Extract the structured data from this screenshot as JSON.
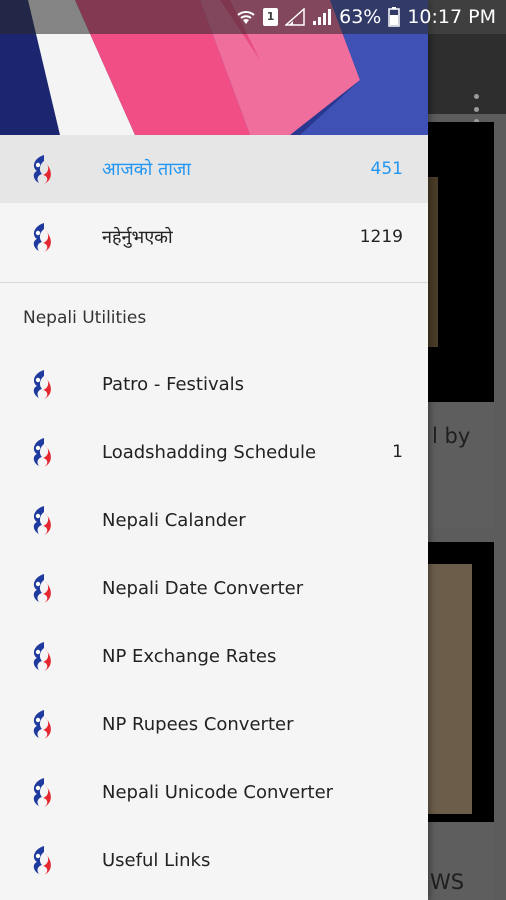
{
  "status_bar": {
    "battery_percent": "63%",
    "time": "10:17 PM",
    "sim_label": "1",
    "icons": [
      "wifi-icon",
      "sim-icon",
      "signal-icon",
      "signal-icon",
      "battery-icon"
    ]
  },
  "background": {
    "snippet_1": "l by",
    "snippet_2": "WS"
  },
  "drawer": {
    "top_items": [
      {
        "label": "आजको ताजा",
        "count": "451",
        "selected": true
      },
      {
        "label": "नहेर्नुभएको",
        "count": "1219",
        "selected": false
      }
    ],
    "section_title": "Nepali Utilities",
    "utility_items": [
      {
        "label": "Patro - Festivals",
        "count": ""
      },
      {
        "label": "Loadshadding Schedule",
        "count": "1"
      },
      {
        "label": "Nepali Calander",
        "count": ""
      },
      {
        "label": "Nepali Date Converter",
        "count": ""
      },
      {
        "label": "NP Exchange Rates",
        "count": ""
      },
      {
        "label": "NP Rupees Converter",
        "count": ""
      },
      {
        "label": "Nepali Unicode Converter",
        "count": ""
      },
      {
        "label": "Useful Links",
        "count": ""
      }
    ]
  },
  "colors": {
    "accent": "#2196f3",
    "header_navy": "#1f2a78",
    "header_pink": "#f0437a",
    "header_blue": "#3f51b5"
  }
}
